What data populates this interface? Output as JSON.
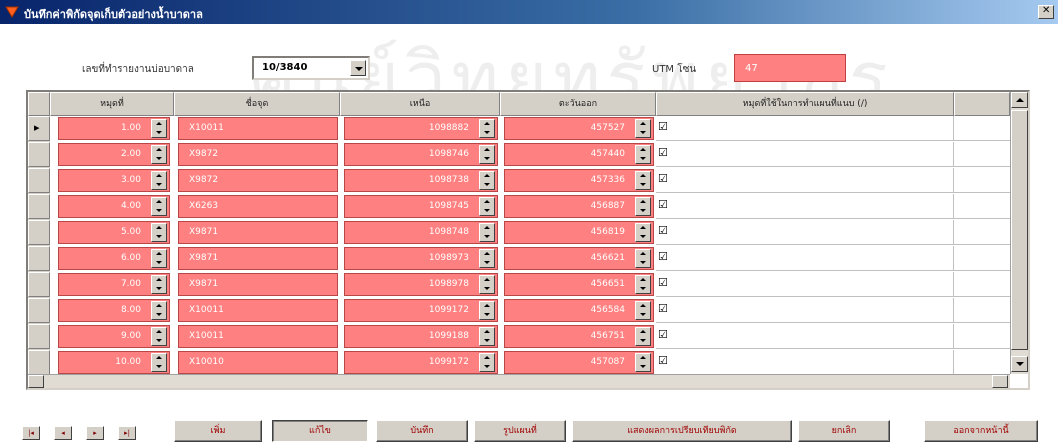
{
  "window": {
    "title": "บันทึกค่าพิกัดจุดเก็บตัวอย่างน้ำบาดาล"
  },
  "form": {
    "period_label": "เลขที่ทำรายงานบ่อบาดาล",
    "period_value": "10/3840",
    "utm_label": "UTM โซน",
    "utm_value": "47"
  },
  "grid": {
    "columns": [
      "หมุดที่",
      "ชื่อจุด",
      "เหนือ",
      "ตะวันออก",
      "หมุดที่ใช้ในการทำแผนที่แนบ (/)"
    ],
    "rows": [
      {
        "no": "1.00",
        "name": "X10011",
        "north": "1098882",
        "east": "457527",
        "checked": "☑"
      },
      {
        "no": "2.00",
        "name": "X9872",
        "north": "1098746",
        "east": "457440",
        "checked": "☑"
      },
      {
        "no": "3.00",
        "name": "X9872",
        "north": "1098738",
        "east": "457336",
        "checked": "☑"
      },
      {
        "no": "4.00",
        "name": "X6263",
        "north": "1098745",
        "east": "456887",
        "checked": "☑"
      },
      {
        "no": "5.00",
        "name": "X9871",
        "north": "1098748",
        "east": "456819",
        "checked": "☑"
      },
      {
        "no": "6.00",
        "name": "X9871",
        "north": "1098973",
        "east": "456621",
        "checked": "☑"
      },
      {
        "no": "7.00",
        "name": "X9871",
        "north": "1098978",
        "east": "456651",
        "checked": "☑"
      },
      {
        "no": "8.00",
        "name": "X10011",
        "north": "1099172",
        "east": "456584",
        "checked": "☑"
      },
      {
        "no": "9.00",
        "name": "X10011",
        "north": "1099188",
        "east": "456751",
        "checked": "☑"
      },
      {
        "no": "10.00",
        "name": "X10010",
        "north": "1099172",
        "east": "457087",
        "checked": "☑"
      }
    ]
  },
  "nav": [
    "|◂",
    "◂",
    "▸",
    "▸|"
  ],
  "buttons": {
    "add": "เพิ่ม",
    "edit": "แก้ไข",
    "save": "บันทึก",
    "image": "รูปแผนที่",
    "report": "แสดงผลการเปรียบเทียบพิกัด",
    "cancel": "ยกเลิก",
    "close": "ออกจากหน้านี้"
  },
  "watermark": "ศูนย์วิทยทรัพยากร จุฬาลงกรณ์มหาวิทยาลัย",
  "colors": {
    "title_bar": "#08246b",
    "cell_fill": "#ff8080",
    "button_text": "#a00000"
  }
}
